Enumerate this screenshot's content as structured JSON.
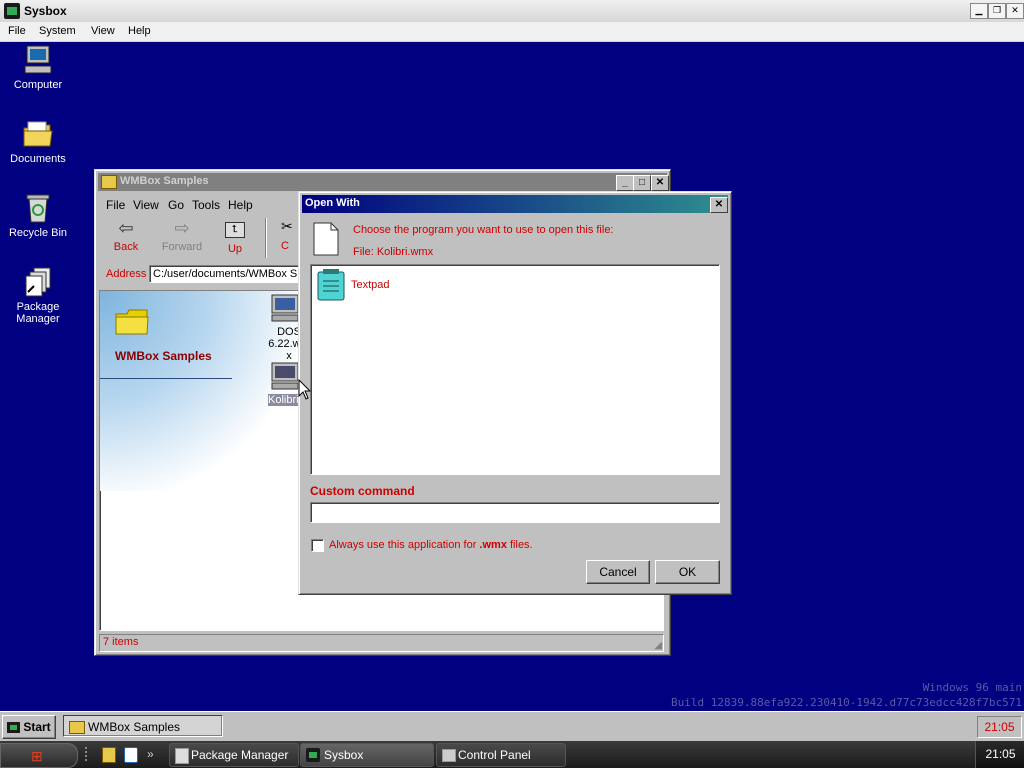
{
  "host": {
    "title": "Sysbox",
    "menu": [
      "File",
      "System",
      "View",
      "Help"
    ]
  },
  "desktop": {
    "icons": [
      {
        "label": "Computer",
        "icon": "computer-icon"
      },
      {
        "label": "Documents",
        "icon": "folder-icon"
      },
      {
        "label": "Recycle Bin",
        "icon": "recycle-bin-icon"
      },
      {
        "label": "Package Manager",
        "icon": "package-icon"
      }
    ]
  },
  "explorer": {
    "title": "WMBox Samples",
    "menu": [
      "File",
      "View",
      "Go",
      "Tools",
      "Help"
    ],
    "toolbar": {
      "back": "Back",
      "forward": "Forward",
      "up": "Up",
      "cut": "C"
    },
    "address_label": "Address",
    "address_value": "C:/user/documents/WMBox S",
    "folder_heading": "WMBox Samples",
    "files": [
      {
        "label": "DOS 6.22.wmx"
      },
      {
        "label": "Kolibri.wmx"
      }
    ],
    "status": "7 items"
  },
  "dialog": {
    "title": "Open With",
    "prompt": "Choose the program you want to use to open this file:",
    "file_line": "File: Kolibri.wmx",
    "programs": [
      {
        "label": "Textpad",
        "icon": "notepad-icon"
      }
    ],
    "custom_label": "Custom command",
    "custom_value": "",
    "always_prefix": "Always use this application for ",
    "always_ext": ".wmx",
    "always_suffix": " files.",
    "always_checked": false,
    "cancel": "Cancel",
    "ok": "OK"
  },
  "taskbar_top": {
    "start": "Start",
    "items": [
      {
        "label": "WMBox Samples"
      }
    ],
    "clock": "21:05"
  },
  "taskbar_bottom": {
    "items": [
      {
        "label": "Package Manager"
      },
      {
        "label": "Sysbox",
        "active": true
      },
      {
        "label": "Control Panel"
      }
    ],
    "clock": "21:05"
  },
  "watermark": {
    "line1": "Windows 96 main",
    "line2": "Build 12839.88efa922.230410-1942.d77c73edcc428f7bc571"
  },
  "colors": {
    "desktop": "#000080",
    "dialog_title_start": "#000080",
    "dialog_title_end": "#2f8f8f",
    "accent_red": "#cc0000"
  }
}
